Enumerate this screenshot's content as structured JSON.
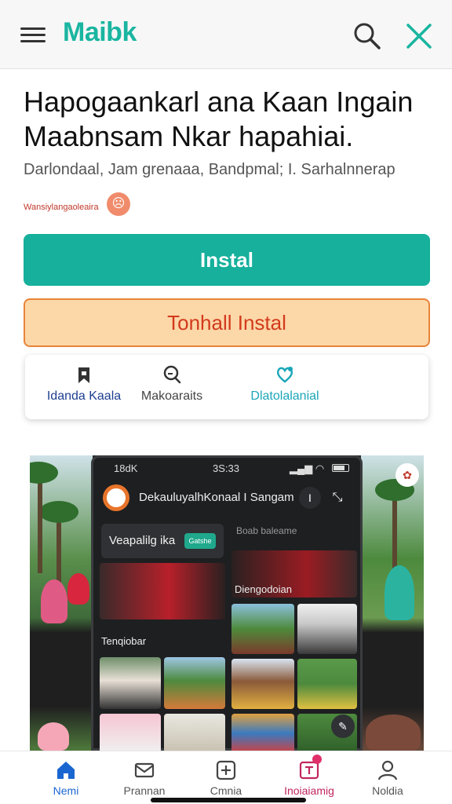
{
  "appbar": {
    "brand": "Maibk",
    "icons": [
      "menu-icon",
      "search-icon",
      "close-icon"
    ]
  },
  "article": {
    "headline": "Hapogaankarl ana Kaan Ingain Maabnsam Nkar hapahiai.",
    "meta": "Darlondaal, Jam grenaaa, Bandpmal; I. Sarhalnnerap",
    "meta_small": "Wansiylangaoleaira"
  },
  "buttons": {
    "install": "Instal",
    "alt_install": "Tonhall Instal"
  },
  "features": [
    {
      "icon": "bookmark-icon",
      "label": "Idanda Kaala"
    },
    {
      "icon": "search-icon",
      "label": "Makoaraits"
    },
    {
      "icon": "heart-chat-icon",
      "label": "Dlatolalanial"
    }
  ],
  "promo": {
    "status_left": "18dK",
    "status_center": "3S:33",
    "app_title": "DekauluyalhKonaal I Sangam",
    "card_label": "Veapalilg ika",
    "card_pill": "Gatshe",
    "sub_label": "Boab baleame",
    "tile_label_1": "Diengodoian",
    "tile_label_2": "Tenqiobar"
  },
  "bottom_nav": [
    {
      "icon": "home-icon",
      "label": "Nemi"
    },
    {
      "icon": "mail-icon",
      "label": "Prannan"
    },
    {
      "icon": "add-square-icon",
      "label": "Cmnia"
    },
    {
      "icon": "notification-icon",
      "label": "Inoiaiamig"
    },
    {
      "icon": "profile-icon",
      "label": "Noldia"
    }
  ],
  "colors": {
    "brand": "#19b5a0",
    "install_bg": "#16b09c",
    "alt_bg": "#fcd7a8",
    "alt_text": "#d23a1c",
    "nav_active": "#1a66d1"
  }
}
